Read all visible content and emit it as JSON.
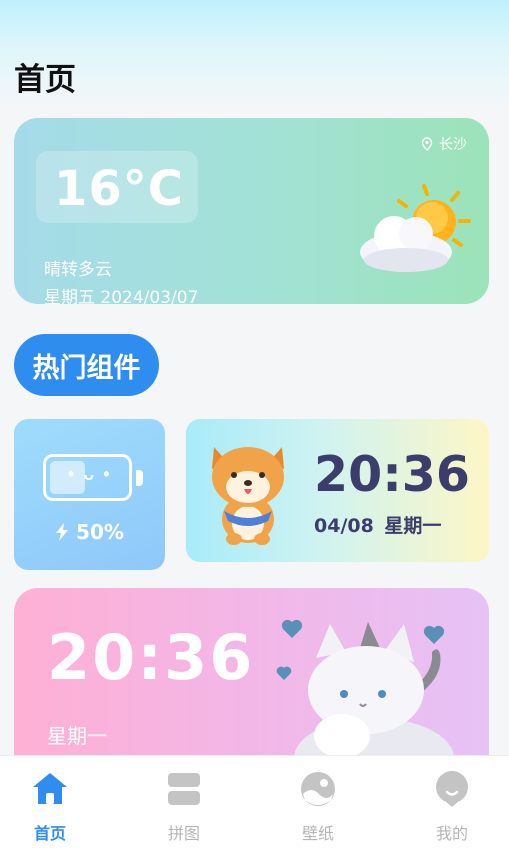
{
  "page": {
    "title": "首页"
  },
  "weather": {
    "temperature": "16°C",
    "location": "长沙",
    "description": "晴转多云",
    "date": "星期五 2024/03/07",
    "location_icon": "location-pin-icon",
    "weather_icon": "partly-cloudy-icon"
  },
  "section": {
    "hot_widgets_label": "热门组件"
  },
  "battery_widget": {
    "percent_label": "50%",
    "level": 0.5,
    "face": "• ᴗ •"
  },
  "dog_widget": {
    "time": "20:36",
    "date": "04/08 星期一"
  },
  "cat_widget": {
    "time": "20:36",
    "day": "星期一"
  },
  "nav": {
    "items": [
      {
        "label": "首页",
        "icon": "home-icon",
        "active": true
      },
      {
        "label": "拼图",
        "icon": "puzzle-layout-icon",
        "active": false
      },
      {
        "label": "壁纸",
        "icon": "wallpaper-icon",
        "active": false
      },
      {
        "label": "我的",
        "icon": "profile-icon",
        "active": false
      }
    ]
  },
  "colors": {
    "accent": "#2f8df0",
    "nav_inactive": "#b6b6b6",
    "clock_text": "#3b3d6b"
  }
}
